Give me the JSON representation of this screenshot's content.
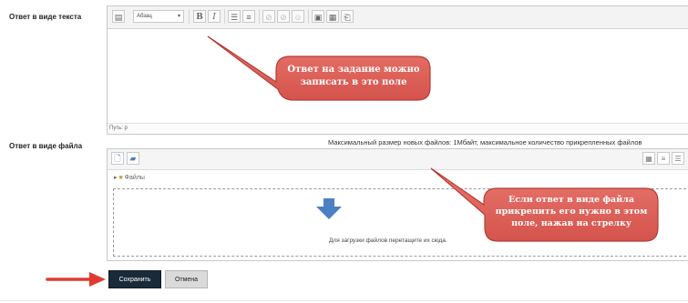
{
  "fields": {
    "text_label": "Ответ в виде текста",
    "file_label": "Ответ в виде файла"
  },
  "editor": {
    "format_select": "Абзац",
    "format_arrow": "▾",
    "bold": "B",
    "italic": "I",
    "path_text": "Путь: p"
  },
  "filemanager": {
    "limits_text": "Максимальный размер новых файлов: 1Мбайт, максимальное количество прикрепленных файлов",
    "path_arrow": "▸",
    "folder_label": "Файлы",
    "drop_text": "Для загрузки файлов перетащите их сюда."
  },
  "buttons": {
    "save": "Сохранить",
    "cancel": "Отмена"
  },
  "callouts": {
    "text_note": [
      "Ответ на задание можно",
      "записать в это поле"
    ],
    "file_note": [
      "Если ответ в виде файла",
      "прикрепить его нужно в этом",
      "поле, нажав на стрелку"
    ]
  },
  "colors": {
    "callout_fill": "#e0625a",
    "callout_stroke": "#b53c36",
    "pointer_arrow": "#e03a2f",
    "drop_arrow": "#4b80c4",
    "save_button": "#1b2a38"
  },
  "icons": {
    "toolbar": [
      "show-more-icon",
      "bold-icon",
      "italic-icon",
      "unordered-list-icon",
      "ordered-list-icon",
      "link-icon",
      "unlink-icon",
      "emoji-icon",
      "image-icon",
      "media-icon",
      "manage-files-icon"
    ],
    "filemanager": [
      "add-file-icon",
      "create-folder-icon",
      "folder-icon",
      "view-icons-icon",
      "view-list-icon",
      "view-tree-icon",
      "download-arrow-icon"
    ]
  }
}
